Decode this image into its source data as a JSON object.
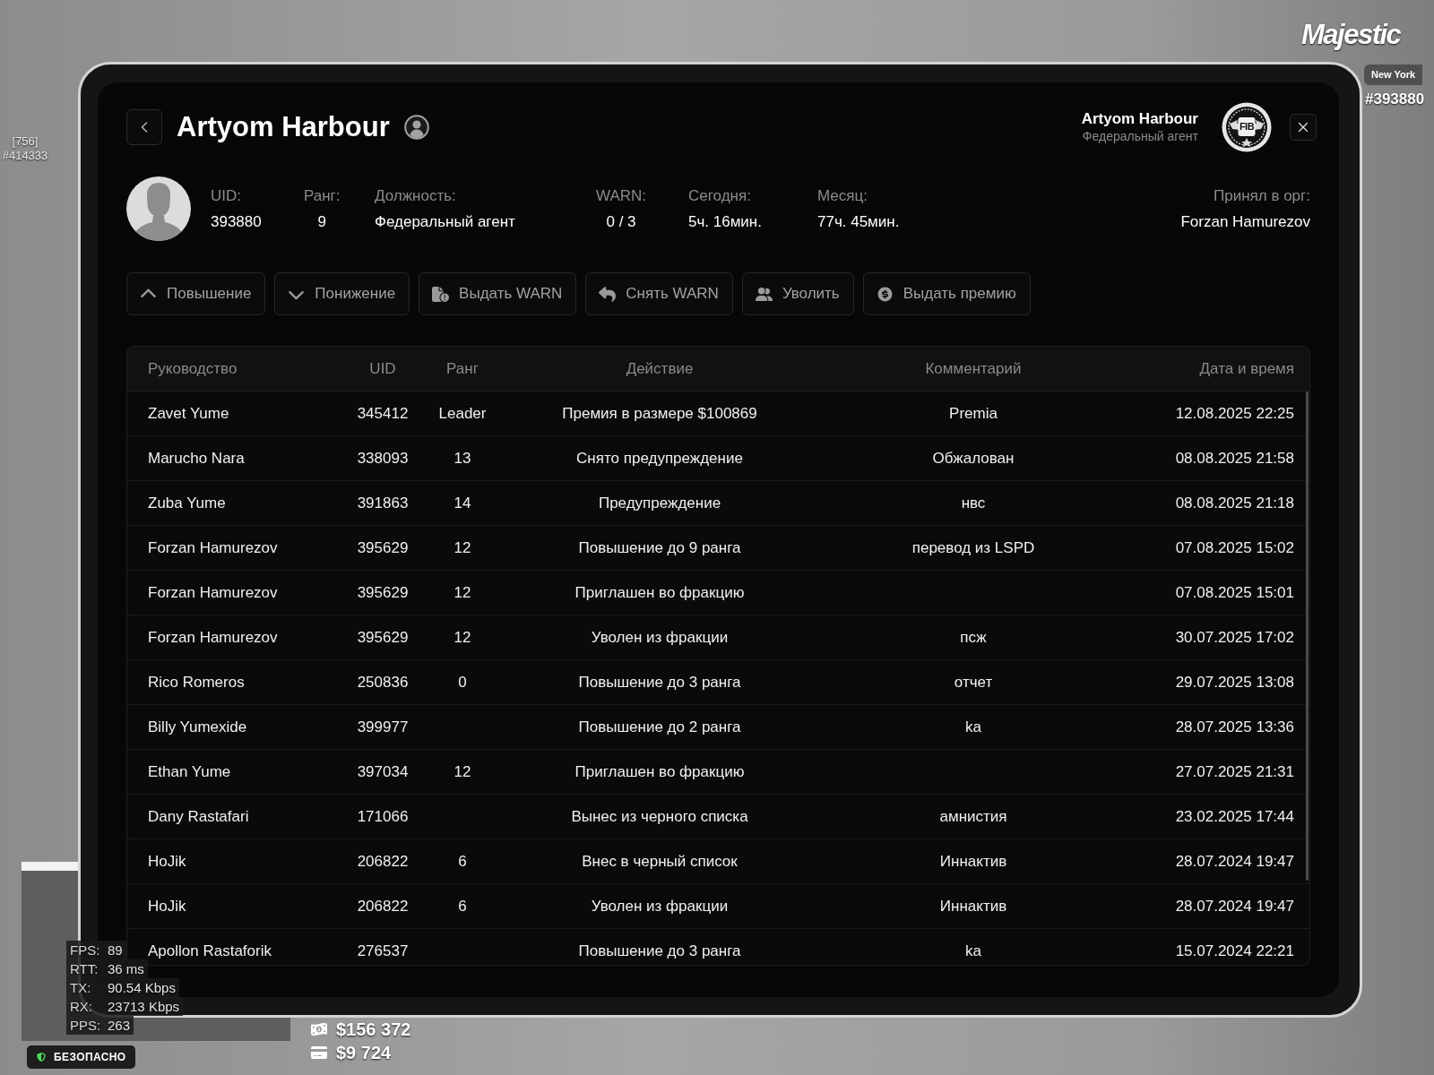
{
  "hud": {
    "logo": "Majestic",
    "location": "New York",
    "player_id": "#393880",
    "nametag": [
      "[756]",
      "#414333"
    ],
    "net_stats": [
      {
        "label": "FPS:",
        "value": "89"
      },
      {
        "label": "RTT:",
        "value": "36 ms"
      },
      {
        "label": "TX:",
        "value": "90.54 Kbps"
      },
      {
        "label": "RX:",
        "value": "23713 Kbps"
      },
      {
        "label": "PPS:",
        "value": "263"
      }
    ],
    "zone": "БЕЗОПАСНО",
    "money": [
      {
        "kind": "cash",
        "amount": "$156 372"
      },
      {
        "kind": "card",
        "amount": "$9 724"
      }
    ]
  },
  "profile": {
    "name": "Artyom Harbour",
    "viewer": {
      "name": "Artyom Harbour",
      "position": "Федеральный агент",
      "emblem": "FIB"
    },
    "stats": [
      {
        "label": "UID:",
        "value": "393880"
      },
      {
        "label": "Ранг:",
        "value": "9"
      },
      {
        "label": "Должность:",
        "value": "Федеральный агент"
      },
      {
        "label": "WARN:",
        "value": "0 / 3"
      },
      {
        "label": "Сегодня:",
        "value": "5ч. 16мин."
      },
      {
        "label": "Месяц:",
        "value": "77ч. 45мин."
      }
    ],
    "recruited_by": {
      "label": "Принял в орг:",
      "value": "Forzan Hamurezov"
    }
  },
  "actions": [
    {
      "kind": "promote",
      "label": "Повышение"
    },
    {
      "kind": "demote",
      "label": "Понижение"
    },
    {
      "kind": "warn",
      "label": "Выдать WARN"
    },
    {
      "kind": "unwarn",
      "label": "Снять WARN"
    },
    {
      "kind": "fire",
      "label": "Уволить"
    },
    {
      "kind": "bonus",
      "label": "Выдать премию"
    }
  ],
  "log": {
    "columns": [
      "Руководство",
      "UID",
      "Ранг",
      "Действие",
      "Комментарий",
      "Дата и время"
    ],
    "rows": [
      {
        "manager": "Zavet Yume",
        "uid": "345412",
        "rank": "Leader",
        "action": "Премия в размере $100869",
        "comment": "Premia",
        "datetime": "12.08.2025 22:25"
      },
      {
        "manager": "Marucho Nara",
        "uid": "338093",
        "rank": "13",
        "action": "Снято предупреждение",
        "comment": "Обжалован",
        "datetime": "08.08.2025 21:58"
      },
      {
        "manager": "Zuba Yume",
        "uid": "391863",
        "rank": "14",
        "action": "Предупреждение",
        "comment": "нвс",
        "datetime": "08.08.2025 21:18"
      },
      {
        "manager": "Forzan Hamurezov",
        "uid": "395629",
        "rank": "12",
        "action": "Повышение до 9 ранга",
        "comment": "перевод из LSPD",
        "datetime": "07.08.2025 15:02"
      },
      {
        "manager": "Forzan Hamurezov",
        "uid": "395629",
        "rank": "12",
        "action": "Приглашен во фракцию",
        "datetime": "07.08.2025 15:01"
      },
      {
        "manager": "Forzan Hamurezov",
        "uid": "395629",
        "rank": "12",
        "action": "Уволен из фракции",
        "comment": "псж",
        "datetime": "30.07.2025 17:02"
      },
      {
        "manager": "Rico Romeros",
        "uid": "250836",
        "rank": "0",
        "action": "Повышение до 3 ранга",
        "comment": "отчет",
        "datetime": "29.07.2025 13:08"
      },
      {
        "manager": "Billy Yumexide",
        "uid": "399977",
        "action": "Повышение до 2 ранга",
        "comment": "ka",
        "datetime": "28.07.2025 13:36"
      },
      {
        "manager": "Ethan Yume",
        "uid": "397034",
        "rank": "12",
        "action": "Приглашен во фракцию",
        "datetime": "27.07.2025 21:31"
      },
      {
        "manager": "Dany Rastafari",
        "uid": "171066",
        "action": "Вынес из черного списка",
        "comment": "амнистия",
        "datetime": "23.02.2025 17:44"
      },
      {
        "manager": "HoJik",
        "uid": "206822",
        "rank": "6",
        "action": "Внес в черный список",
        "comment": "Иннактив",
        "datetime": "28.07.2024 19:47"
      },
      {
        "manager": "HoJik",
        "uid": "206822",
        "rank": "6",
        "action": "Уволен из фракции",
        "comment": "Иннактив",
        "datetime": "28.07.2024 19:47"
      },
      {
        "manager": "Apollon Rastaforik",
        "uid": "276537",
        "action": "Повышение до 3 ранга",
        "comment": "ka",
        "datetime": "15.07.2024 22:21"
      }
    ]
  }
}
